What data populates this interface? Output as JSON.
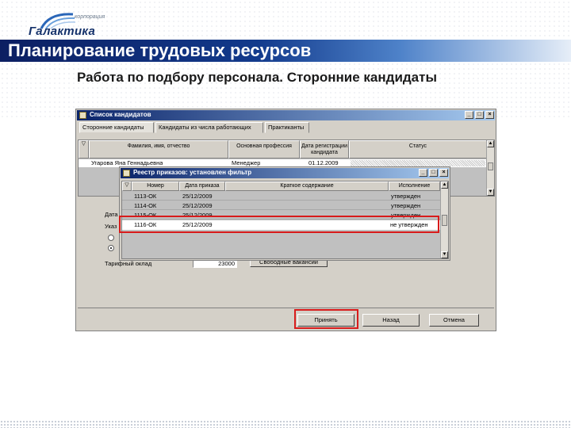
{
  "logo": {
    "corp": "корпорация",
    "name": "Галактика"
  },
  "page_title": "Планирование трудовых ресурсов",
  "page_subtitle": "Работа по подбору персонала. Сторонние кандидаты",
  "main_window": {
    "title": "Список кандидатов",
    "controls": [
      "_",
      "□",
      "×"
    ],
    "tabs": [
      "Сторонние кандидаты",
      "Кандидаты из числа работающих",
      "Практиканты"
    ],
    "columns": [
      "Фамилия, имя, отчество",
      "Основная профессия",
      "Дата регистрации кандидата",
      "Статус"
    ],
    "rows": [
      {
        "name": "Угарова Яна Геннадьевна",
        "profession": "Менеджер",
        "date": "01.12.2009",
        "status": ""
      }
    ],
    "labels": {
      "dot": "Дата",
      "uka": "Указ",
      "salary": "Тарифный оклад"
    },
    "salary_value": "23000",
    "free_vacancies_button": "Свободные вакансии",
    "buttons": {
      "apply": "Принять",
      "back": "Назад",
      "cancel": "Отмена"
    }
  },
  "registry_window": {
    "title": "Реестр приказов: установлен фильтр",
    "controls": [
      "_",
      "□",
      "×"
    ],
    "columns": [
      "Номер",
      "Дата приказа",
      "Краткое содержание",
      "Исполнение"
    ],
    "rows": [
      {
        "num": "1113-ОК",
        "date": "25/12/2009",
        "content": "",
        "status": "утвержден"
      },
      {
        "num": "1114-ОК",
        "date": "25/12/2009",
        "content": "",
        "status": "утвержден"
      },
      {
        "num": "1115-ОК",
        "date": "25/12/2009",
        "content": "",
        "status": "утвержден"
      },
      {
        "num": "1116-ОК",
        "date": "25/12/2009",
        "content": "",
        "status": "не утвержден"
      }
    ]
  }
}
